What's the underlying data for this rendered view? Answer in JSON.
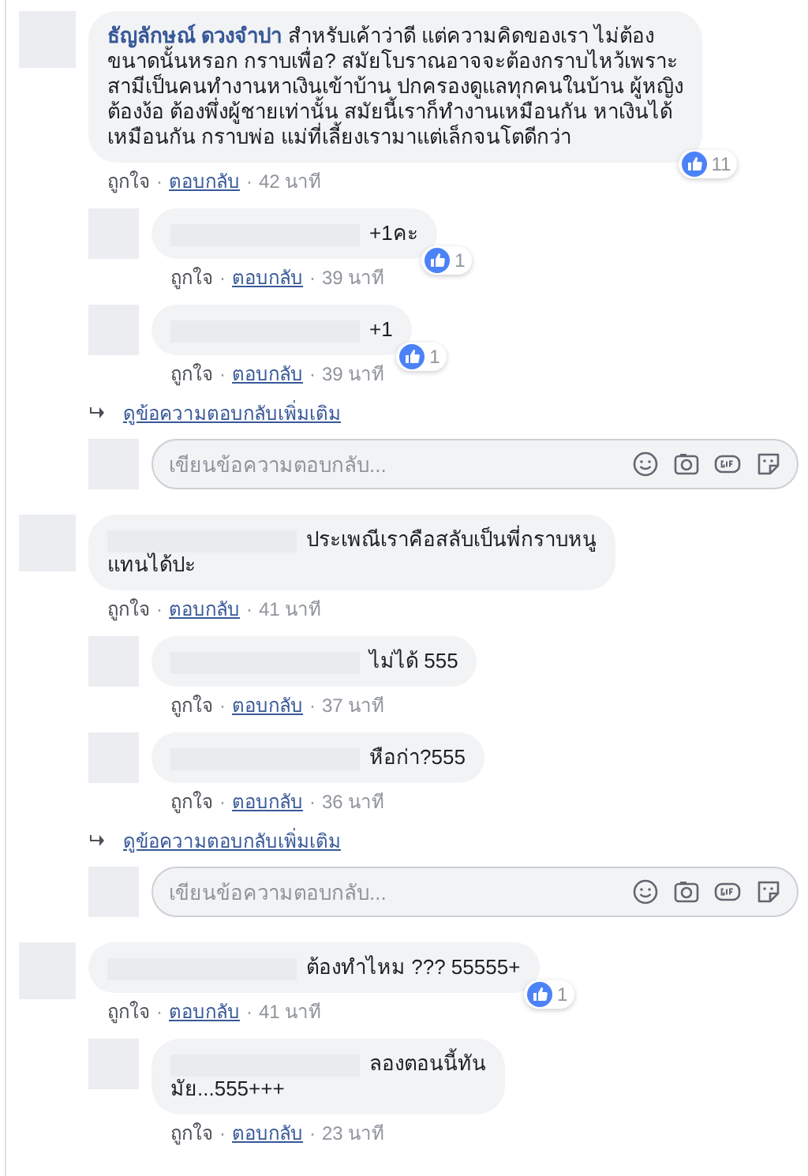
{
  "action_separator": "·",
  "comments": [
    {
      "author": "ธัญลักษณ์ ดวงจำปา",
      "author_hidden": false,
      "lines": [
        "สำหรับเค้าว่าดี แต่ความคิดของเรา ไม่ต้อง",
        "ขนาดนั้นหรอก กราบเพื่อ? สมัยโบราณอาจจะต้องกราบไหว้เพราะ",
        "สามีเป็นคนทำงานหาเงินเข้าบ้าน ปกครองดูแลทุกคนในบ้าน ผู้หญิง",
        "ต้องง้อ ต้องพึ่งผู้ชายเท่านั้น สมัยนี้เราก็ทำงานเหมือนกัน หาเงินได้",
        "เหมือนกัน กราบพ่อ แม่ที่เลี้ยงเรามาแต่เล็กจนโตดีกว่า"
      ],
      "likes": "11",
      "actions": [
        "ถูกใจ",
        "ตอบกลับ",
        "42 นาที"
      ],
      "replies": [
        {
          "author_hidden": true,
          "lines": [
            "+1คะ"
          ],
          "likes": "1",
          "actions": [
            "ถูกใจ",
            "ตอบกลับ",
            "39 นาที"
          ]
        },
        {
          "author_hidden": true,
          "lines": [
            "+1"
          ],
          "likes": "1",
          "actions": [
            "ถูกใจ",
            "ตอบกลับ",
            "39 นาที"
          ]
        }
      ],
      "more_replies": "ดูข้อความตอบกลับเพิ่มเติม",
      "reply_box": {
        "placeholder": "เขียนข้อความตอบกลับ..."
      }
    },
    {
      "author_hidden": true,
      "lines": [
        "ประเพณีเราคือสลับเป็นพี่กราบหนู",
        "แทนได้ปะ"
      ],
      "actions": [
        "ถูกใจ",
        "ตอบกลับ",
        "41 นาที"
      ],
      "replies": [
        {
          "author_hidden": true,
          "lines": [
            "ไม่ได้ 555"
          ],
          "actions": [
            "ถูกใจ",
            "ตอบกลับ",
            "37 นาที"
          ]
        },
        {
          "author_hidden": true,
          "lines": [
            "หือก่า?555"
          ],
          "actions": [
            "ถูกใจ",
            "ตอบกลับ",
            "36 นาที"
          ]
        }
      ],
      "more_replies": "ดูข้อความตอบกลับเพิ่มเติม",
      "reply_box": {
        "placeholder": "เขียนข้อความตอบกลับ..."
      }
    },
    {
      "author_hidden": true,
      "lines": [
        "ต้องทำไหม ??? 55555+"
      ],
      "likes": "1",
      "actions": [
        "ถูกใจ",
        "ตอบกลับ",
        "41 นาที"
      ],
      "replies": [
        {
          "author_hidden": true,
          "lines": [
            "ลองตอนนี้ทัน",
            "มัย...555+++"
          ],
          "actions": [
            "ถูกใจ",
            "ตอบกลับ",
            "23 นาที"
          ]
        }
      ]
    }
  ]
}
